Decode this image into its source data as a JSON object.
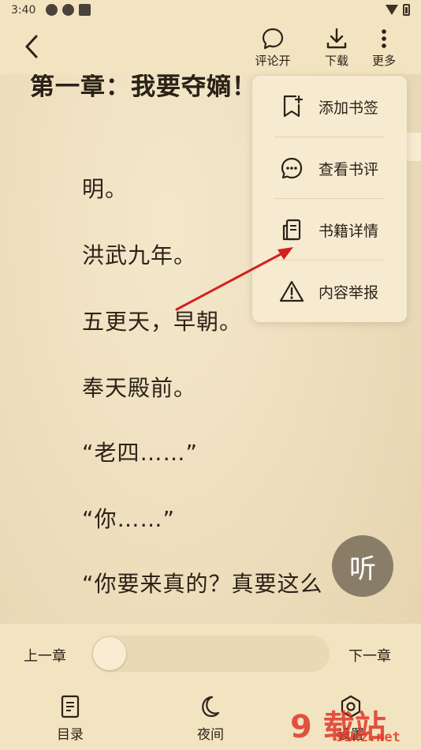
{
  "status_bar": {
    "time": "3:40"
  },
  "top_bar": {
    "back_icon": "chevron-left-icon",
    "actions": [
      {
        "label": "评论开",
        "icon": "comment-icon"
      },
      {
        "label": "下载",
        "icon": "download-icon"
      },
      {
        "label": "更多",
        "icon": "more-vertical-icon"
      }
    ]
  },
  "content": {
    "chapter_title": "第一章：我要夺嫡！",
    "paragraphs": [
      "明。",
      "洪武九年。",
      "五更天，早朝。",
      "奉天殿前。",
      "“老四……”",
      "“你……”",
      "“你要来真的？真要这么"
    ]
  },
  "more_menu": {
    "items": [
      {
        "label": "添加书签",
        "icon": "bookmark-add-icon"
      },
      {
        "label": "查看书评",
        "icon": "comment-dots-icon"
      },
      {
        "label": "书籍详情",
        "icon": "book-detail-icon"
      },
      {
        "label": "内容举报",
        "icon": "warning-icon"
      }
    ]
  },
  "listen_button": {
    "label": "听"
  },
  "chapter_nav": {
    "prev_label": "上一章",
    "next_label": "下一章",
    "progress": 0.0
  },
  "bottom_nav": [
    {
      "label": "目录",
      "icon": "catalog-icon"
    },
    {
      "label": "夜间",
      "icon": "moon-icon"
    },
    {
      "label": "设置",
      "icon": "settings-icon"
    }
  ],
  "watermark": {
    "text": "9 载站",
    "domain": "91xz.net"
  },
  "colors": {
    "background": "#ede0c0",
    "bar": "#f3e4c1",
    "menu": "#f6ebd1",
    "text": "#2b2218",
    "listen_button": "#8a7d68",
    "arrow": "#d42020"
  }
}
